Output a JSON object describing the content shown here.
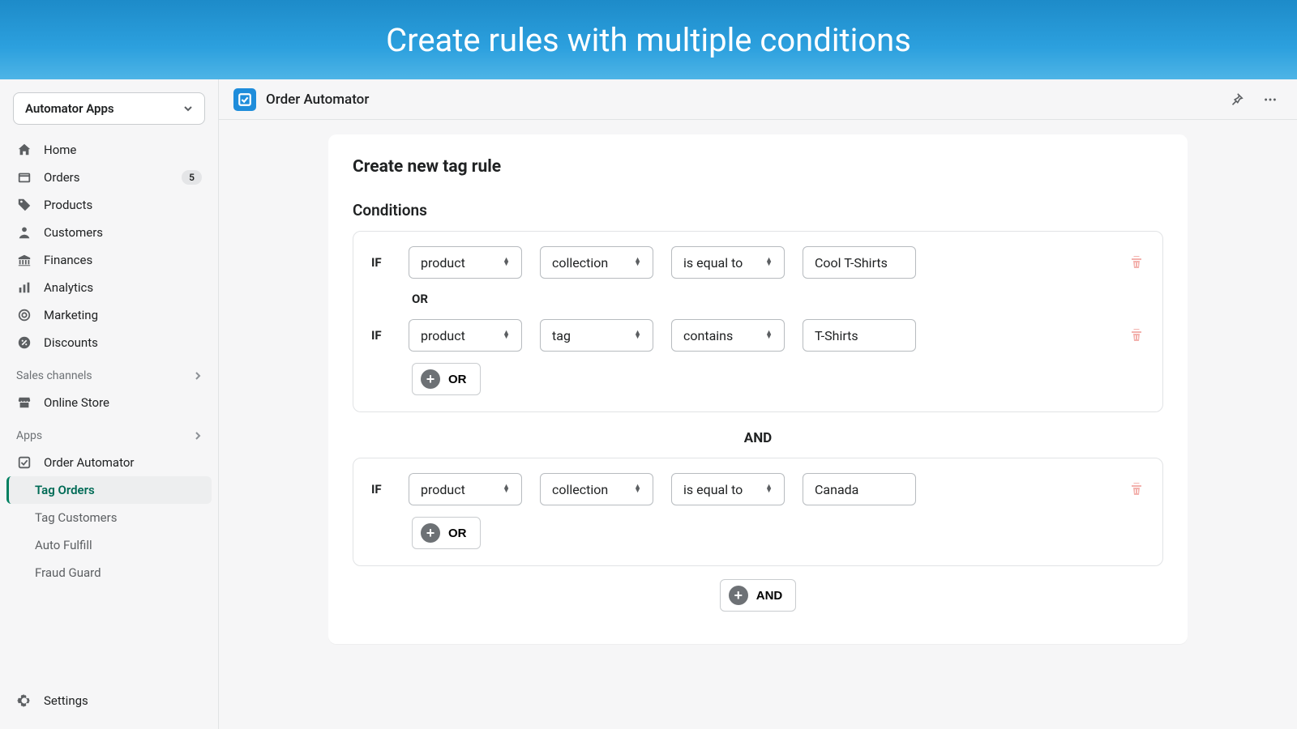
{
  "banner": {
    "title": "Create rules with multiple conditions"
  },
  "store_selector": {
    "label": "Automator Apps"
  },
  "sidebar": {
    "items": [
      {
        "label": "Home",
        "icon": "home"
      },
      {
        "label": "Orders",
        "icon": "orders",
        "badge": "5"
      },
      {
        "label": "Products",
        "icon": "tag"
      },
      {
        "label": "Customers",
        "icon": "person"
      },
      {
        "label": "Finances",
        "icon": "bank"
      },
      {
        "label": "Analytics",
        "icon": "bars"
      },
      {
        "label": "Marketing",
        "icon": "target"
      },
      {
        "label": "Discounts",
        "icon": "discount"
      }
    ],
    "sales_channels_label": "Sales channels",
    "online_store": {
      "label": "Online Store"
    },
    "apps_label": "Apps",
    "app_item": {
      "label": "Order Automator"
    },
    "app_sub": [
      {
        "label": "Tag Orders",
        "active": true
      },
      {
        "label": "Tag Customers"
      },
      {
        "label": "Auto Fulfill"
      },
      {
        "label": "Fraud Guard"
      }
    ],
    "settings_label": "Settings"
  },
  "topbar": {
    "app_name": "Order Automator"
  },
  "page": {
    "title": "Create new tag rule",
    "conditions_heading": "Conditions",
    "if_label": "IF",
    "or_label": "OR",
    "and_label": "AND",
    "add_or_label": "OR",
    "add_and_label": "AND",
    "groups": [
      {
        "conditions": [
          {
            "subject": "product",
            "field": "collection",
            "op": "is equal to",
            "value": "Cool T-Shirts"
          },
          {
            "subject": "product",
            "field": "tag",
            "op": "contains",
            "value": "T-Shirts"
          }
        ]
      },
      {
        "conditions": [
          {
            "subject": "product",
            "field": "collection",
            "op": "is equal to",
            "value": "Canada"
          }
        ]
      }
    ]
  }
}
